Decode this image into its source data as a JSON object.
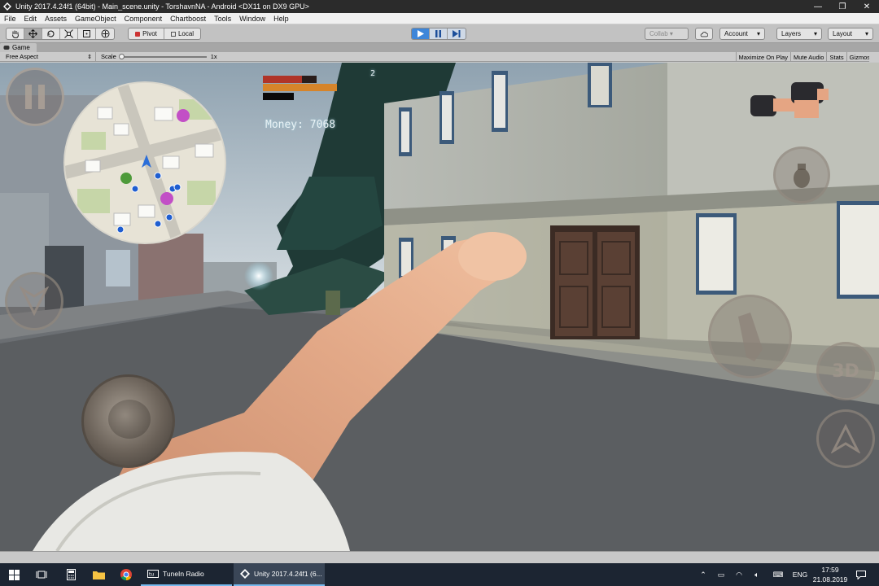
{
  "window": {
    "title": "Unity 2017.4.24f1 (64bit) - Main_scene.unity - TorshavnNA - Android <DX11 on DX9 GPU>",
    "minimize": "—",
    "maximize": "❐",
    "close": "✕"
  },
  "menu": [
    "File",
    "Edit",
    "Assets",
    "GameObject",
    "Component",
    "Chartboost",
    "Tools",
    "Window",
    "Help"
  ],
  "toolbar": {
    "pivot_label": "Pivot",
    "local_label": "Local",
    "collab_label": "Collab ▾",
    "account_label": "Account",
    "layers_label": "Layers",
    "layout_label": "Layout"
  },
  "game_panel": {
    "tab_label": "Game",
    "aspect_label": "Free Aspect",
    "scale_label": "Scale",
    "scale_value": "1x",
    "maximize_label": "Maximize On Play",
    "mute_label": "Mute Audio",
    "stats_label": "Stats",
    "gizmos_label": "Gizmos"
  },
  "hud": {
    "money_text": "Money: 7068",
    "level_value": "2",
    "health_fraction": 0.72,
    "stamina_fraction": 1.0
  },
  "taskbar": {
    "app1_label": "TuneIn Radio",
    "app2_label": "Unity 2017.4.24f1 (6...",
    "language": "ENG",
    "time": "17:59",
    "date": "21.08.2019"
  },
  "colors": {
    "accent_play": "#3e86d9",
    "health": "#b03428",
    "stamina": "#d6842a"
  }
}
